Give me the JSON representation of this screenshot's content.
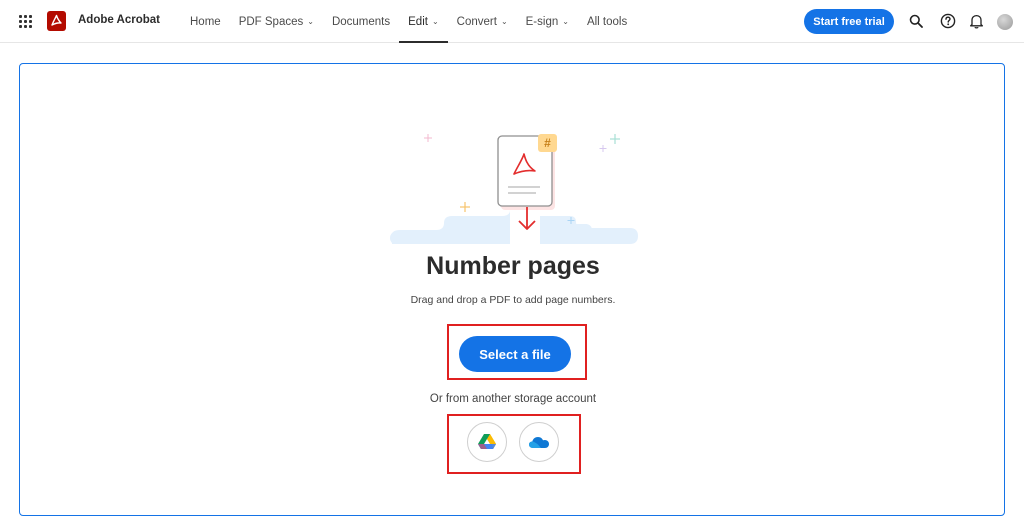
{
  "header": {
    "brand": "Adobe Acrobat",
    "nav": [
      {
        "label": "Home",
        "chevron": ""
      },
      {
        "label": "PDF Spaces",
        "chevron": "⌄"
      },
      {
        "label": "Documents",
        "chevron": ""
      },
      {
        "label": "Edit",
        "chevron": "⌄"
      },
      {
        "label": "Convert",
        "chevron": "⌄"
      },
      {
        "label": "E-sign",
        "chevron": "⌄"
      },
      {
        "label": "All tools",
        "chevron": ""
      }
    ],
    "active_nav": "Edit",
    "trial_button": "Start free trial",
    "icons": [
      "apps-grid-icon",
      "acrobat-logo-icon",
      "search-icon",
      "help-icon",
      "bell-icon",
      "avatar"
    ]
  },
  "main": {
    "title": "Number pages",
    "subtitle": "Drag and drop a PDF to add page numbers.",
    "select_button": "Select a file",
    "storage_text": "Or from another storage account",
    "storage_icons": [
      "google-drive-icon",
      "onedrive-icon"
    ],
    "badge": "#"
  },
  "colors": {
    "accent": "#1473e6",
    "acrobat_red": "#b30b00",
    "highlight_box": "#e02020",
    "badge_bg": "#ffd890"
  }
}
